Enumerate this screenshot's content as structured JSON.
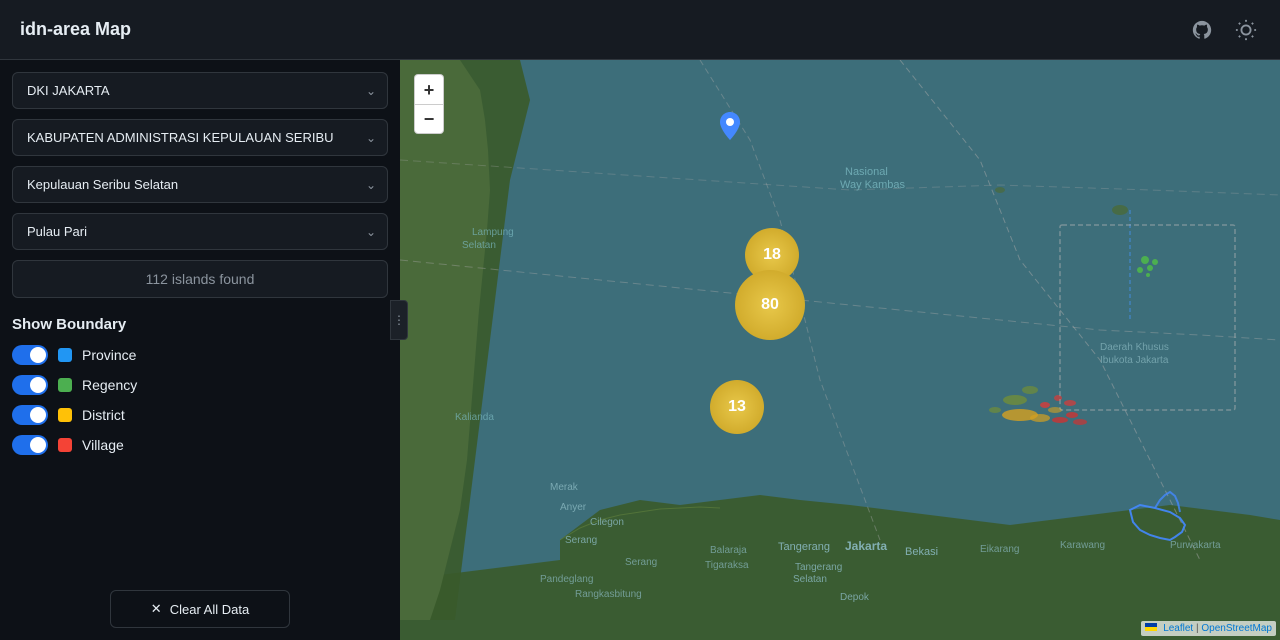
{
  "header": {
    "title": "idn-area Map",
    "github_icon": "⊙",
    "theme_icon": "◑"
  },
  "sidebar": {
    "province_label": "Province select",
    "province_value": "DKI JAKARTA",
    "regency_value": "KABUPATEN ADMINISTRASI KEPULAUAN SERIBU",
    "district_value": "Kepulauan Seribu Selatan",
    "village_value": "Pulau Pari",
    "islands_found": "112 islands found",
    "show_boundary_title": "Show Boundary",
    "boundaries": [
      {
        "id": "province",
        "label": "Province",
        "color": "#2196F3"
      },
      {
        "id": "regency",
        "label": "Regency",
        "color": "#4CAF50"
      },
      {
        "id": "district",
        "label": "District",
        "color": "#FFC107"
      },
      {
        "id": "village",
        "label": "Village",
        "color": "#F44336"
      }
    ],
    "clear_btn_label": "Clear All Data",
    "clear_icon": "✕"
  },
  "map": {
    "zoom_in": "+",
    "zoom_out": "−",
    "cluster_18": "18",
    "cluster_80": "80",
    "cluster_13": "13",
    "attribution_leaflet": "Leaflet",
    "attribution_osm": "OpenStreetMap"
  },
  "dropdowns": {
    "province_options": [
      "DKI JAKARTA"
    ],
    "regency_options": [
      "KABUPATEN ADMINISTRASI KEPULAUAN SERIBU"
    ],
    "district_options": [
      "Kepulauan Seribu Selatan"
    ],
    "village_options": [
      "Pulau Pari"
    ]
  }
}
